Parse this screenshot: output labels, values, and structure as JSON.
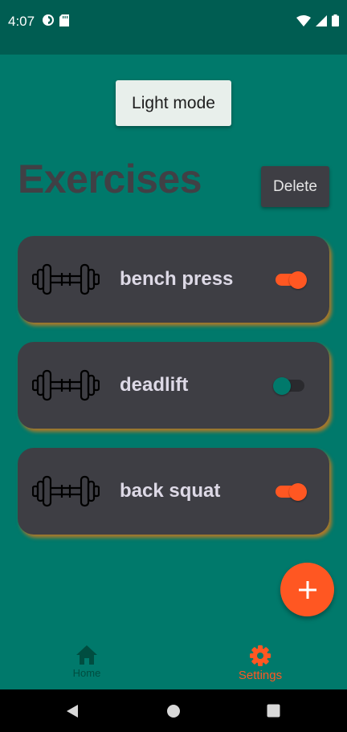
{
  "status_bar": {
    "time": "4:07",
    "left_icons": [
      "data-saver-icon",
      "sd-card-icon"
    ],
    "right_icons": [
      "wifi-icon",
      "cell-signal-icon",
      "battery-icon"
    ]
  },
  "theme_button": {
    "label": "Light mode"
  },
  "header": {
    "title": "Exercises",
    "delete_label": "Delete"
  },
  "exercises": [
    {
      "name": "bench press",
      "icon": "dumbbell-icon",
      "enabled": true
    },
    {
      "name": "deadlift",
      "icon": "dumbbell-icon",
      "enabled": false
    },
    {
      "name": "back squat",
      "icon": "dumbbell-icon",
      "enabled": true
    }
  ],
  "fab": {
    "icon": "plus-icon"
  },
  "bottom_nav": {
    "items": [
      {
        "label": "Home",
        "icon": "home-icon",
        "active": false
      },
      {
        "label": "Settings",
        "icon": "gear-icon",
        "active": true
      }
    ]
  },
  "system_nav": {
    "icons": [
      "back-icon",
      "home-circle-icon",
      "recents-icon"
    ]
  },
  "colors": {
    "background": "#00796b",
    "status_bar": "#005d52",
    "card": "#3e3e44",
    "accent": "#ff5722",
    "title": "#404045",
    "card_text": "#ddd9e6",
    "nav_home": "#004d40"
  }
}
